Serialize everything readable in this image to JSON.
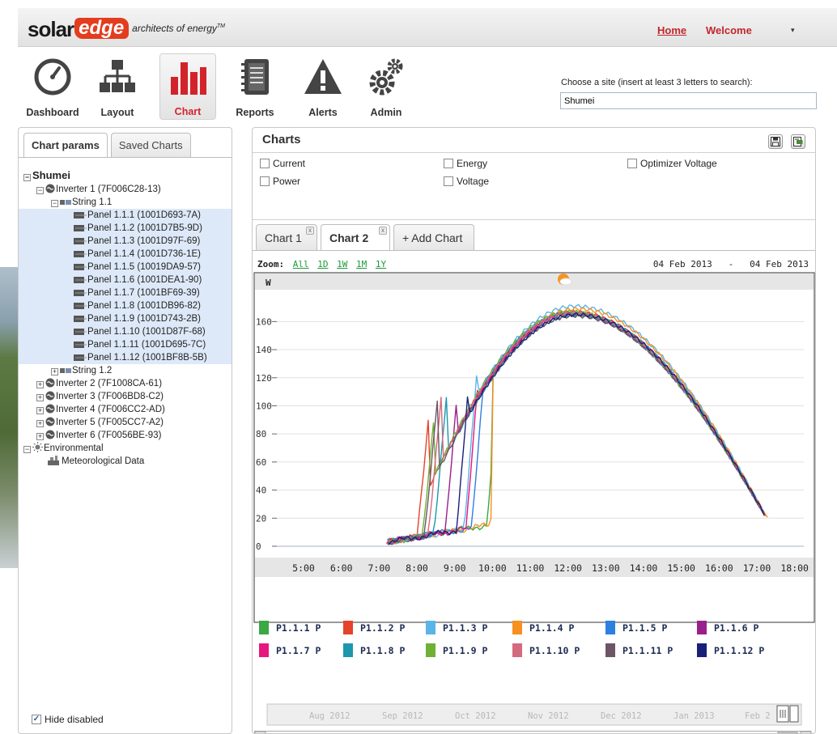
{
  "header": {
    "logo_solar": "solar",
    "logo_edge": "edge",
    "logo_tagline": "architects of energy",
    "logo_tm": "TM",
    "home": "Home",
    "welcome": "Welcome",
    "user_caret": "▾"
  },
  "nav": {
    "dashboard": "Dashboard",
    "layout": "Layout",
    "chart": "Chart",
    "reports": "Reports",
    "alerts": "Alerts",
    "admin": "Admin"
  },
  "site": {
    "label": "Choose a site (insert at least 3 letters to search):",
    "value": "Shumei"
  },
  "left_tabs": {
    "chart_params": "Chart params",
    "saved_charts": "Saved Charts"
  },
  "tree": {
    "root": "Shumei",
    "inverter1": "Inverter 1 (7F006C28-13)",
    "string11": "String 1.1",
    "panels": [
      "Panel 1.1.1 (1001D693-7A)",
      "Panel 1.1.2 (1001D7B5-9D)",
      "Panel 1.1.3 (1001D97F-69)",
      "Panel 1.1.4 (1001D736-1E)",
      "Panel 1.1.5 (10019DA9-57)",
      "Panel 1.1.6 (1001DEA1-90)",
      "Panel 1.1.7 (1001BF69-39)",
      "Panel 1.1.8 (1001DB96-82)",
      "Panel 1.1.9 (1001D743-2B)",
      "Panel 1.1.10 (1001D87F-68)",
      "Panel 1.1.11 (1001D695-7C)",
      "Panel 1.1.12 (1001BF8B-5B)"
    ],
    "string12": "String 1.2",
    "inverters": [
      "Inverter 2 (7F1008CA-61)",
      "Inverter 3 (7F006BD8-C2)",
      "Inverter 4 (7F006CC2-AD)",
      "Inverter 5 (7F005CC7-A2)",
      "Inverter 6 (7F0056BE-93)"
    ],
    "environmental": "Environmental",
    "meteo": "Meteorological Data"
  },
  "hide_disabled": "Hide disabled",
  "charts_panel": {
    "title": "Charts",
    "measures": {
      "current": "Current",
      "energy": "Energy",
      "optimizer_voltage": "Optimizer Voltage",
      "power": "Power",
      "voltage": "Voltage"
    },
    "tabs": {
      "chart1": "Chart 1",
      "chart2": "Chart 2",
      "add": "+ Add Chart"
    },
    "close_glyph": "x",
    "zoom_label": "Zoom:",
    "zoom_options": {
      "all": "All",
      "d1": "1D",
      "w1": "1W",
      "m1": "1M",
      "y1": "1Y"
    },
    "date_from": "04 Feb 2013",
    "date_sep": "-",
    "date_to": "04 Feb 2013"
  },
  "navigator_labels": [
    "Aug 2012",
    "Sep 2012",
    "Oct 2012",
    "Nov 2012",
    "Dec 2012",
    "Jan 2013",
    "Feb 2"
  ],
  "chart_data": {
    "type": "line",
    "ylabel": "W",
    "ylim": [
      0,
      170
    ],
    "y_ticks": [
      0,
      20,
      40,
      60,
      80,
      100,
      120,
      140,
      160
    ],
    "x_ticks": [
      "5:00",
      "6:00",
      "7:00",
      "8:00",
      "9:00",
      "10:00",
      "11:00",
      "12:00",
      "13:00",
      "14:00",
      "15:00",
      "16:00",
      "17:00",
      "18:00"
    ],
    "xlim_hours": [
      4.25,
      18.5
    ],
    "grid": true,
    "legend_position": "bottom",
    "series": [
      {
        "name": "P1.1.1 P",
        "color": "#3aa843",
        "rise": 9.85,
        "peak": 166,
        "end": 17.2
      },
      {
        "name": "P1.1.2 P",
        "color": "#e5432c",
        "rise": 8.0,
        "peak": 167,
        "end": 17.25
      },
      {
        "name": "P1.1.3 P",
        "color": "#5ab4e6",
        "rise": 9.25,
        "peak": 171,
        "end": 17.15
      },
      {
        "name": "P1.1.4 P",
        "color": "#f7901e",
        "rise": 9.95,
        "peak": 169,
        "end": 17.3
      },
      {
        "name": "P1.1.5 P",
        "color": "#2d7fe0",
        "rise": 9.45,
        "peak": 166,
        "end": 17.2
      },
      {
        "name": "P1.1.6 P",
        "color": "#9a1f8a",
        "rise": 8.75,
        "peak": 165,
        "end": 17.2
      },
      {
        "name": "P1.1.7 P",
        "color": "#e8177d",
        "rise": 9.3,
        "peak": 166,
        "end": 17.25
      },
      {
        "name": "P1.1.8 P",
        "color": "#1c97ae",
        "rise": 8.45,
        "peak": 165,
        "end": 17.2
      },
      {
        "name": "P1.1.9 P",
        "color": "#6fb135",
        "rise": 8.15,
        "peak": 167,
        "end": 17.25
      },
      {
        "name": "P1.1.10 P",
        "color": "#d46a7d",
        "rise": 8.3,
        "peak": 166,
        "end": 17.2
      },
      {
        "name": "P1.1.11 P",
        "color": "#6c5566",
        "rise": 8.2,
        "peak": 164,
        "end": 17.2
      },
      {
        "name": "P1.1.12 P",
        "color": "#1a1f7a",
        "rise": 9.05,
        "peak": 165,
        "end": 17.25
      }
    ]
  }
}
